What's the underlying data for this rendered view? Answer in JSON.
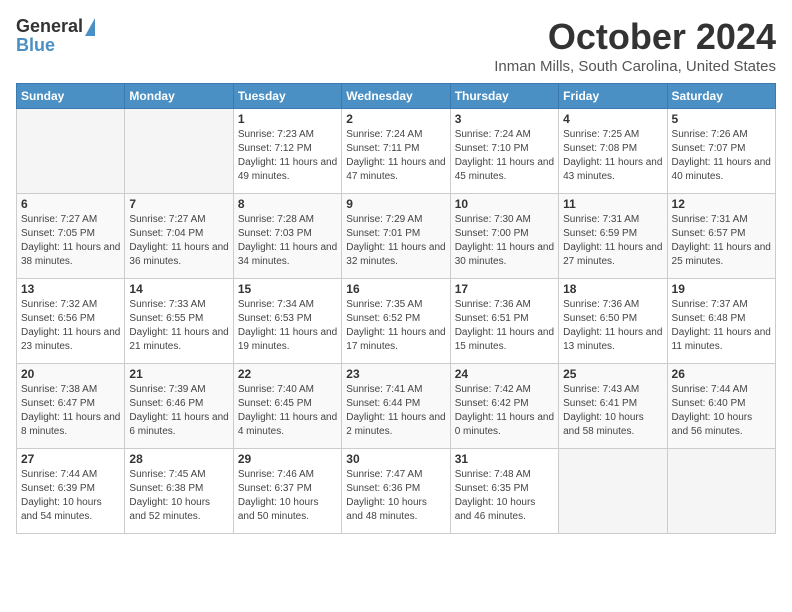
{
  "logo": {
    "general": "General",
    "blue": "Blue"
  },
  "title": "October 2024",
  "location": "Inman Mills, South Carolina, United States",
  "days_of_week": [
    "Sunday",
    "Monday",
    "Tuesday",
    "Wednesday",
    "Thursday",
    "Friday",
    "Saturday"
  ],
  "weeks": [
    [
      {
        "day": "",
        "info": ""
      },
      {
        "day": "",
        "info": ""
      },
      {
        "day": "1",
        "info": "Sunrise: 7:23 AM\nSunset: 7:12 PM\nDaylight: 11 hours and 49 minutes."
      },
      {
        "day": "2",
        "info": "Sunrise: 7:24 AM\nSunset: 7:11 PM\nDaylight: 11 hours and 47 minutes."
      },
      {
        "day": "3",
        "info": "Sunrise: 7:24 AM\nSunset: 7:10 PM\nDaylight: 11 hours and 45 minutes."
      },
      {
        "day": "4",
        "info": "Sunrise: 7:25 AM\nSunset: 7:08 PM\nDaylight: 11 hours and 43 minutes."
      },
      {
        "day": "5",
        "info": "Sunrise: 7:26 AM\nSunset: 7:07 PM\nDaylight: 11 hours and 40 minutes."
      }
    ],
    [
      {
        "day": "6",
        "info": "Sunrise: 7:27 AM\nSunset: 7:05 PM\nDaylight: 11 hours and 38 minutes."
      },
      {
        "day": "7",
        "info": "Sunrise: 7:27 AM\nSunset: 7:04 PM\nDaylight: 11 hours and 36 minutes."
      },
      {
        "day": "8",
        "info": "Sunrise: 7:28 AM\nSunset: 7:03 PM\nDaylight: 11 hours and 34 minutes."
      },
      {
        "day": "9",
        "info": "Sunrise: 7:29 AM\nSunset: 7:01 PM\nDaylight: 11 hours and 32 minutes."
      },
      {
        "day": "10",
        "info": "Sunrise: 7:30 AM\nSunset: 7:00 PM\nDaylight: 11 hours and 30 minutes."
      },
      {
        "day": "11",
        "info": "Sunrise: 7:31 AM\nSunset: 6:59 PM\nDaylight: 11 hours and 27 minutes."
      },
      {
        "day": "12",
        "info": "Sunrise: 7:31 AM\nSunset: 6:57 PM\nDaylight: 11 hours and 25 minutes."
      }
    ],
    [
      {
        "day": "13",
        "info": "Sunrise: 7:32 AM\nSunset: 6:56 PM\nDaylight: 11 hours and 23 minutes."
      },
      {
        "day": "14",
        "info": "Sunrise: 7:33 AM\nSunset: 6:55 PM\nDaylight: 11 hours and 21 minutes."
      },
      {
        "day": "15",
        "info": "Sunrise: 7:34 AM\nSunset: 6:53 PM\nDaylight: 11 hours and 19 minutes."
      },
      {
        "day": "16",
        "info": "Sunrise: 7:35 AM\nSunset: 6:52 PM\nDaylight: 11 hours and 17 minutes."
      },
      {
        "day": "17",
        "info": "Sunrise: 7:36 AM\nSunset: 6:51 PM\nDaylight: 11 hours and 15 minutes."
      },
      {
        "day": "18",
        "info": "Sunrise: 7:36 AM\nSunset: 6:50 PM\nDaylight: 11 hours and 13 minutes."
      },
      {
        "day": "19",
        "info": "Sunrise: 7:37 AM\nSunset: 6:48 PM\nDaylight: 11 hours and 11 minutes."
      }
    ],
    [
      {
        "day": "20",
        "info": "Sunrise: 7:38 AM\nSunset: 6:47 PM\nDaylight: 11 hours and 8 minutes."
      },
      {
        "day": "21",
        "info": "Sunrise: 7:39 AM\nSunset: 6:46 PM\nDaylight: 11 hours and 6 minutes."
      },
      {
        "day": "22",
        "info": "Sunrise: 7:40 AM\nSunset: 6:45 PM\nDaylight: 11 hours and 4 minutes."
      },
      {
        "day": "23",
        "info": "Sunrise: 7:41 AM\nSunset: 6:44 PM\nDaylight: 11 hours and 2 minutes."
      },
      {
        "day": "24",
        "info": "Sunrise: 7:42 AM\nSunset: 6:42 PM\nDaylight: 11 hours and 0 minutes."
      },
      {
        "day": "25",
        "info": "Sunrise: 7:43 AM\nSunset: 6:41 PM\nDaylight: 10 hours and 58 minutes."
      },
      {
        "day": "26",
        "info": "Sunrise: 7:44 AM\nSunset: 6:40 PM\nDaylight: 10 hours and 56 minutes."
      }
    ],
    [
      {
        "day": "27",
        "info": "Sunrise: 7:44 AM\nSunset: 6:39 PM\nDaylight: 10 hours and 54 minutes."
      },
      {
        "day": "28",
        "info": "Sunrise: 7:45 AM\nSunset: 6:38 PM\nDaylight: 10 hours and 52 minutes."
      },
      {
        "day": "29",
        "info": "Sunrise: 7:46 AM\nSunset: 6:37 PM\nDaylight: 10 hours and 50 minutes."
      },
      {
        "day": "30",
        "info": "Sunrise: 7:47 AM\nSunset: 6:36 PM\nDaylight: 10 hours and 48 minutes."
      },
      {
        "day": "31",
        "info": "Sunrise: 7:48 AM\nSunset: 6:35 PM\nDaylight: 10 hours and 46 minutes."
      },
      {
        "day": "",
        "info": ""
      },
      {
        "day": "",
        "info": ""
      }
    ]
  ]
}
